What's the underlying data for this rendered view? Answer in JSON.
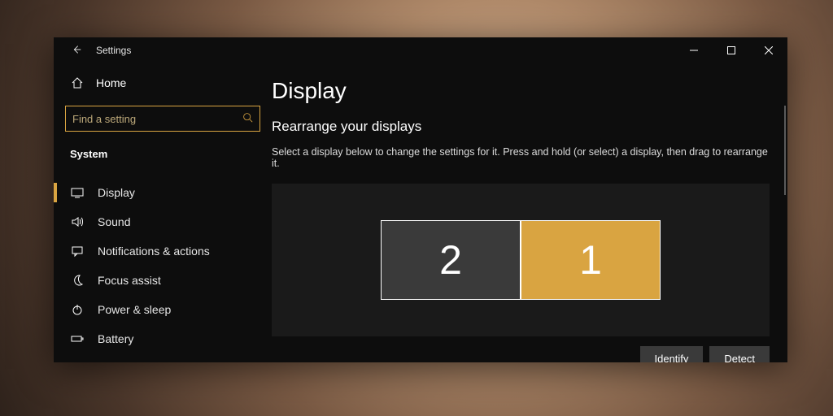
{
  "app": {
    "name": "Settings"
  },
  "titlebar": {
    "back_icon": "←",
    "min_label": "Minimize",
    "max_label": "Maximize",
    "close_label": "Close"
  },
  "sidebar": {
    "home_label": "Home",
    "search_placeholder": "Find a setting",
    "category_label": "System",
    "items": [
      {
        "key": "display",
        "label": "Display",
        "icon": "monitor",
        "selected": true
      },
      {
        "key": "sound",
        "label": "Sound",
        "icon": "speaker",
        "selected": false
      },
      {
        "key": "notifications",
        "label": "Notifications & actions",
        "icon": "message",
        "selected": false
      },
      {
        "key": "focus",
        "label": "Focus assist",
        "icon": "moon",
        "selected": false
      },
      {
        "key": "power",
        "label": "Power & sleep",
        "icon": "power",
        "selected": false
      },
      {
        "key": "battery",
        "label": "Battery",
        "icon": "battery",
        "selected": false
      }
    ]
  },
  "main": {
    "title": "Display",
    "subtitle": "Rearrange your displays",
    "description": "Select a display below to change the settings for it. Press and hold (or select) a display, then drag to rearrange it.",
    "monitors": [
      {
        "id": "2",
        "selected": false
      },
      {
        "id": "1",
        "selected": true
      }
    ],
    "buttons": {
      "identify": "Identify",
      "detect": "Detect"
    }
  },
  "colors": {
    "accent": "#d9a441",
    "window_bg": "#0d0d0d",
    "canvas_bg": "#1a1a1a",
    "monitor_unselected": "#3a3a3a"
  }
}
